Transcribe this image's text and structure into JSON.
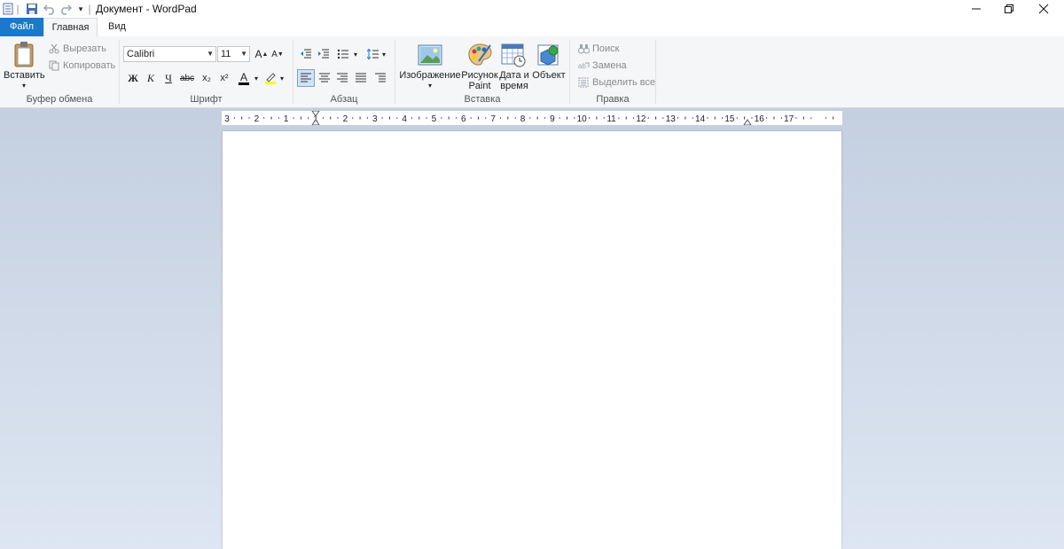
{
  "window": {
    "title": "Документ - WordPad",
    "minimize_icon": "minimize-icon",
    "restore_icon": "restore-icon",
    "close_icon": "close-icon"
  },
  "quick_access": [
    "wordpad-app-icon",
    "save-icon",
    "undo-icon",
    "redo-icon",
    "customize-qat-icon"
  ],
  "tabs": {
    "file": "Файл",
    "home": "Главная",
    "view": "Вид"
  },
  "ribbon": {
    "clipboard": {
      "label": "Буфер обмена",
      "paste": "Вставить",
      "cut": "Вырезать",
      "copy": "Копировать"
    },
    "font": {
      "label": "Шрифт",
      "family": "Calibri",
      "size": "11",
      "bold": "Ж",
      "italic": "К",
      "underline": "Ч",
      "strike": "abc",
      "subscript": "x₂",
      "superscript": "x²",
      "color_letter": "A"
    },
    "paragraph": {
      "label": "Абзац"
    },
    "insert": {
      "label": "Вставка",
      "image": "Изображение",
      "paint_1": "Рисунок",
      "paint_2": "Paint",
      "datetime_1": "Дата и",
      "datetime_2": "время",
      "object": "Объект"
    },
    "editing": {
      "label": "Правка",
      "find": "Поиск",
      "replace": "Замена",
      "select_all": "Выделить все"
    }
  },
  "ruler": {
    "marks": [
      "3",
      "2",
      "1",
      "1",
      "2",
      "3",
      "4",
      "5",
      "6",
      "7",
      "8",
      "9",
      "10",
      "11",
      "12",
      "13",
      "14",
      "15",
      "16",
      "17"
    ]
  },
  "colors": {
    "accent": "#1979ca",
    "ribbon_bg": "#f5f6f7",
    "workspace_top": "#c4cfe0",
    "workspace_bottom": "#dde6f2",
    "font_color_bar": "#000000",
    "highlight_bar": "#ffff00"
  }
}
